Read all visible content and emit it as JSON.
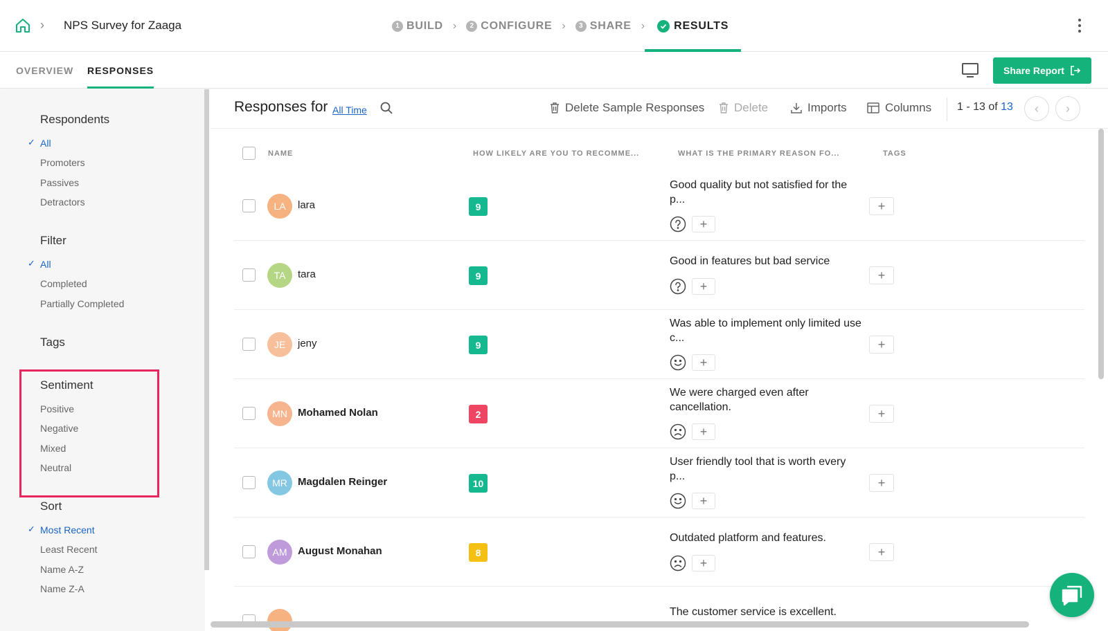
{
  "header": {
    "survey_title": "NPS Survey for Zaaga",
    "steps": [
      {
        "num": "1",
        "label": "BUILD"
      },
      {
        "num": "2",
        "label": "CONFIGURE"
      },
      {
        "num": "3",
        "label": "SHARE"
      },
      {
        "label": "RESULTS",
        "active": true
      }
    ]
  },
  "subnav": {
    "tabs": [
      "OVERVIEW",
      "RESPONSES"
    ],
    "active_tab": "RESPONSES",
    "share_label": "Share Report"
  },
  "sidebar": {
    "respondents": {
      "title": "Respondents",
      "options": [
        "All",
        "Promoters",
        "Passives",
        "Detractors"
      ],
      "selected": "All"
    },
    "filter": {
      "title": "Filter",
      "options": [
        "All",
        "Completed",
        "Partially Completed"
      ],
      "selected": "All"
    },
    "tags": {
      "title": "Tags"
    },
    "sentiment": {
      "title": "Sentiment",
      "options": [
        "Positive",
        "Negative",
        "Mixed",
        "Neutral"
      ]
    },
    "sort": {
      "title": "Sort",
      "options": [
        "Most Recent",
        "Least Recent",
        "Name A-Z",
        "Name Z-A"
      ],
      "selected": "Most Recent"
    }
  },
  "toolbar": {
    "title": "Responses for",
    "range": "All Time",
    "delete_sample": "Delete Sample Responses",
    "delete": "Delete",
    "imports": "Imports",
    "columns": "Columns",
    "pager_range": "1 - 13 of",
    "pager_total": "13"
  },
  "table": {
    "headers": {
      "name": "NAME",
      "score": "HOW LIKELY ARE YOU TO RECOMME...",
      "reason": "WHAT IS THE PRIMARY REASON FO...",
      "tags": "TAGS"
    },
    "rows": [
      {
        "initials": "LA",
        "name": "lara",
        "score": "9",
        "reason": "Good quality but not satisfied for the p...",
        "sentiment_icon": "question-icon",
        "avatar_color": "#f5a56b",
        "score_color": "#16b890",
        "name_bold": false
      },
      {
        "initials": "TA",
        "name": "tara",
        "score": "9",
        "reason": "Good in features but bad service",
        "sentiment_icon": "question-icon",
        "avatar_color": "#a8d070",
        "score_color": "#16b890",
        "name_bold": false
      },
      {
        "initials": "JE",
        "name": "jeny",
        "score": "9",
        "reason": "Was able to implement only limited use c...",
        "sentiment_icon": "smile-icon",
        "avatar_color": "#f7b48a",
        "score_color": "#16b890",
        "name_bold": false
      },
      {
        "initials": "MN",
        "name": "Mohamed Nolan",
        "score": "2",
        "reason": "We were charged even after cancellation.",
        "sentiment_icon": "frown-icon",
        "avatar_color": "#f5a77c",
        "score_color": "#ee4563",
        "name_bold": true
      },
      {
        "initials": "MR",
        "name": "Magdalen Reinger",
        "score": "10",
        "reason": "User friendly tool that is worth every p...",
        "sentiment_icon": "smile-icon",
        "avatar_color": "#6fbedd",
        "score_color": "#16b890",
        "name_bold": true
      },
      {
        "initials": "AM",
        "name": "August Monahan",
        "score": "8",
        "reason": "Outdated platform and features.",
        "sentiment_icon": "frown-icon",
        "avatar_color": "#b48ad6",
        "score_color": "#f4c014",
        "name_bold": true
      },
      {
        "initials": "",
        "name": "",
        "score": "",
        "reason": "The customer service is excellent.",
        "sentiment_icon": "",
        "avatar_color": "#f5a56b",
        "score_color": "#16b890",
        "name_bold": false
      }
    ]
  },
  "colors": {
    "accent": "#16b27c",
    "link": "#1a64c8",
    "highlight": "#e8265e"
  }
}
